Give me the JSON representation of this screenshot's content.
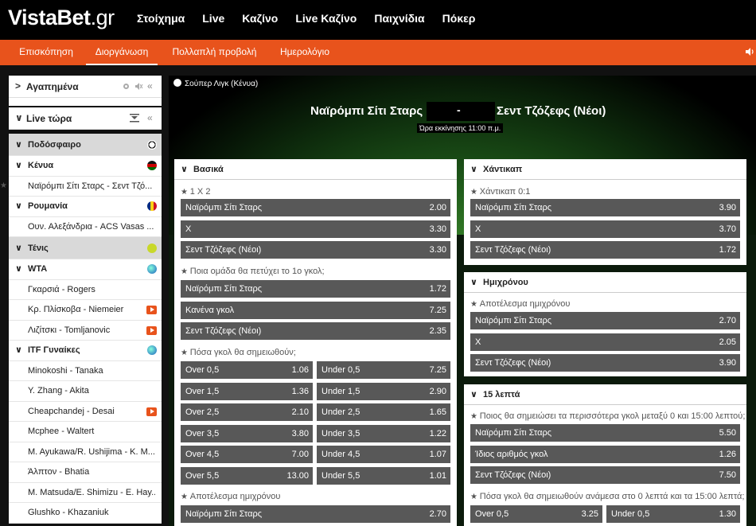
{
  "header": {
    "logo_main": "VistaBet",
    "logo_suffix": ".gr",
    "nav": [
      "Στοίχημα",
      "Live",
      "Καζίνο",
      "Live Καζίνο",
      "Παιχνίδια",
      "Πόκερ"
    ]
  },
  "subnav": {
    "items": [
      "Επισκόπηση",
      "Διοργάνωση",
      "Πολλαπλή προβολή",
      "Ημερολόγιο"
    ],
    "active": "Διοργάνωση"
  },
  "sidebar": {
    "favorites_title": "Αγαπημένα",
    "live_title": "Live τώρα",
    "rows": [
      {
        "type": "sport",
        "label": "Ποδόσφαιρο",
        "icon": "soccer-ball-icon"
      },
      {
        "type": "country",
        "label": "Κένυα",
        "icon": "flag-kenya-icon"
      },
      {
        "type": "event",
        "label": "Ναϊρόμπι Σίτι Σταρς - Σεντ Τζό...",
        "starred": true
      },
      {
        "type": "country",
        "label": "Ρουμανία",
        "icon": "flag-romania-icon"
      },
      {
        "type": "event",
        "label": "Ουν. Αλεξάνδρια - ACS Vasas ..."
      },
      {
        "type": "sport",
        "label": "Τένις",
        "icon": "tennis-ball-icon"
      },
      {
        "type": "country",
        "label": "WTA",
        "icon": "globe-icon"
      },
      {
        "type": "event",
        "label": "Γκαρσιά - Rogers"
      },
      {
        "type": "event",
        "label": "Κρ. Πλίσκοβα - Niemeier",
        "tv": true
      },
      {
        "type": "event",
        "label": "Λιζίτσκι - Tomljanovic",
        "tv": true
      },
      {
        "type": "country",
        "label": "ITF Γυναίκες",
        "icon": "globe-icon"
      },
      {
        "type": "event",
        "label": "Minokoshi - Tanaka"
      },
      {
        "type": "event",
        "label": "Y. Zhang - Akita"
      },
      {
        "type": "event",
        "label": "Cheapchandej - Desai",
        "tv": true
      },
      {
        "type": "event",
        "label": "Mcphee - Waltert"
      },
      {
        "type": "event",
        "label": "M. Ayukawa/R. Ushijima - K. M..."
      },
      {
        "type": "event",
        "label": "Άλπτον - Bhatia"
      },
      {
        "type": "event",
        "label": "M. Matsuda/E. Shimizu - E. Hay..."
      },
      {
        "type": "event",
        "label": "Glushko - Khazaniuk"
      }
    ]
  },
  "match": {
    "league": "Σούπερ Λιγκ (Κένυα)",
    "home": "Ναϊρόμπι Σίτι Σταρς",
    "separator": "-",
    "away": "Σεντ Τζόζεφς (Νέοι)",
    "kickoff": "Ώρα εκκίνησης 11:00 π.μ."
  },
  "left_col": {
    "title": "Βασικά",
    "m1_title": "1 X 2",
    "m1": [
      [
        "Ναϊρόμπι Σίτι Σταρς",
        "2.00"
      ],
      [
        "X",
        "3.30"
      ],
      [
        "Σεντ Τζόζεφς (Νέοι)",
        "3.30"
      ]
    ],
    "m2_title": "Ποια ομάδα θα πετύχει το 1ο γκολ;",
    "m2": [
      [
        "Ναϊρόμπι Σίτι Σταρς",
        "1.72"
      ],
      [
        "Κανένα γκολ",
        "7.25"
      ],
      [
        "Σεντ Τζόζεφς (Νέοι)",
        "2.35"
      ]
    ],
    "m3_title": "Πόσα γκολ θα σημειωθούν;",
    "m3": [
      [
        [
          "Over 0,5",
          "1.06"
        ],
        [
          "Under 0,5",
          "7.25"
        ]
      ],
      [
        [
          "Over 1,5",
          "1.36"
        ],
        [
          "Under 1,5",
          "2.90"
        ]
      ],
      [
        [
          "Over 2,5",
          "2.10"
        ],
        [
          "Under 2,5",
          "1.65"
        ]
      ],
      [
        [
          "Over 3,5",
          "3.80"
        ],
        [
          "Under 3,5",
          "1.22"
        ]
      ],
      [
        [
          "Over 4,5",
          "7.00"
        ],
        [
          "Under 4,5",
          "1.07"
        ]
      ],
      [
        [
          "Over 5,5",
          "13.00"
        ],
        [
          "Under 5,5",
          "1.01"
        ]
      ]
    ],
    "m4_title": "Αποτέλεσμα ημιχρόνου",
    "m4": [
      [
        "Ναϊρόμπι Σίτι Σταρς",
        "2.70"
      ]
    ]
  },
  "right_col": {
    "handicap_title": "Χάντικαπ",
    "h_market": "Χάντικαπ 0:1",
    "h": [
      [
        "Ναϊρόμπι Σίτι Σταρς",
        "3.90"
      ],
      [
        "X",
        "3.70"
      ],
      [
        "Σεντ Τζόζεφς (Νέοι)",
        "1.72"
      ]
    ],
    "half_title": "Ημιχρόνου",
    "half_market": "Αποτέλεσμα ημιχρόνου",
    "half": [
      [
        "Ναϊρόμπι Σίτι Σταρς",
        "2.70"
      ],
      [
        "X",
        "2.05"
      ],
      [
        "Σεντ Τζόζεφς (Νέοι)",
        "3.90"
      ]
    ],
    "min15_title": "15 λεπτά",
    "min15_market": "Ποιος θα σημειώσει τα περισσότερα γκολ μεταξύ 0 και 15:00 λεπτού;",
    "min15": [
      [
        "Ναϊρόμπι Σίτι Σταρς",
        "5.50"
      ],
      [
        "Ίδιος αριθμός γκολ",
        "1.26"
      ],
      [
        "Σεντ Τζόζεφς (Νέοι)",
        "7.50"
      ]
    ],
    "goals15_market": "Πόσα γκολ θα σημειωθούν ανάμεσα στο 0 λεπτά και τα 15:00 λεπτά;",
    "goals15": [
      [
        "Over 0,5",
        "3.25"
      ],
      [
        "Under 0,5",
        "1.30"
      ]
    ]
  },
  "colors": {
    "accent": "#e8531c",
    "odds_bg": "#585858"
  }
}
